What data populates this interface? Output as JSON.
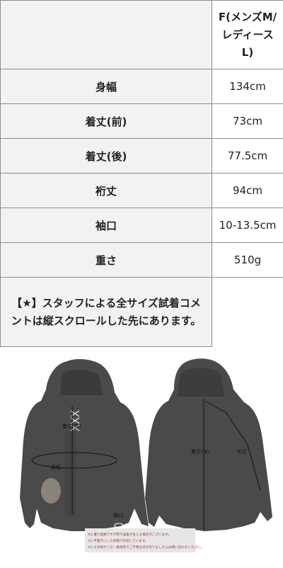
{
  "table": {
    "header_value": "F(メンズM/レディースL)",
    "rows": [
      {
        "label": "身幅",
        "value": "134cm"
      },
      {
        "label": "着丈(前)",
        "value": "73cm"
      },
      {
        "label": "着丈(後)",
        "value": "77.5cm"
      },
      {
        "label": "裄丈",
        "value": "94cm"
      },
      {
        "label": "袖口",
        "value": "10-13.5cm"
      },
      {
        "label": "重さ",
        "value": "510g"
      }
    ],
    "note": "【★】スタッフによる全サイズ試着コメントは縦スクロールした先にあります。"
  },
  "figure": {
    "labels": {
      "front_length": "着丈(前)",
      "chest_width": "身幅",
      "cuff": "袖口",
      "back_length": "着丈(後)",
      "sleeve_length": "裄丈"
    },
    "notes": [
      "※1 撮り直数ですが若干誤差が生じる場合がございます。",
      "※2 平置きにした状態で計測しています。",
      "※3 その他サイズ・素材等でご不明な点がありましたらお問い合わせください。"
    ],
    "colors": {
      "garment": "#4a4a4a",
      "garment_shadow": "#333333",
      "background": "#ffffff",
      "note_box": "#e6e6e6",
      "note_text": "#b03030"
    }
  }
}
